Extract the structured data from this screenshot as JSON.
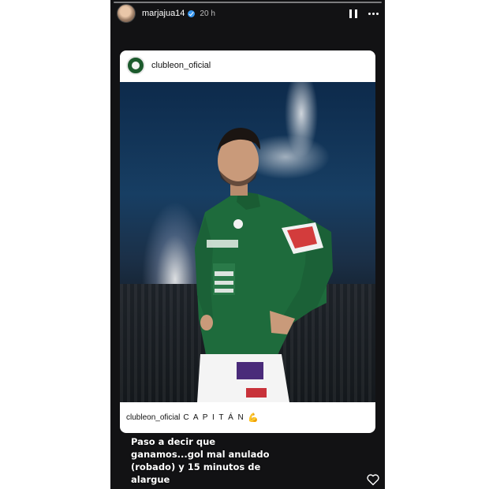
{
  "story": {
    "username": "marjajua14",
    "time_ago": "20 h",
    "text": "Paso a decir que ganamos...gol mal anulado (robado) y 15 minutos de alargue"
  },
  "shared_post": {
    "account": "clubleon_oficial",
    "caption_user": "clubleon_oficial",
    "caption": "C A P I T Á N",
    "caption_emoji": "muscle-icon"
  },
  "icons": {
    "pause": "pause-icon",
    "more": "more-options-icon",
    "like": "heart-icon",
    "verified": "verified-badge-icon"
  },
  "colors": {
    "story_bg": "#121214",
    "verified": "#3897f0",
    "jersey_green": "#1e6b3c"
  }
}
